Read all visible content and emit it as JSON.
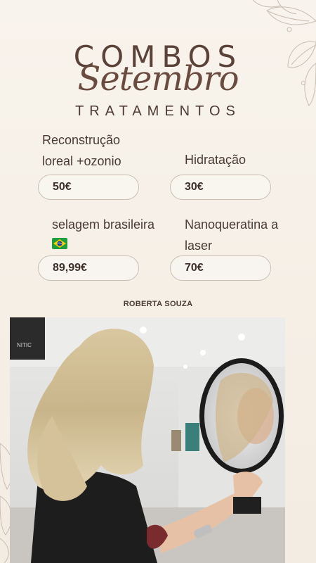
{
  "header": {
    "title": "COMBOS",
    "script": "Setembro",
    "subtitle": "TRATAMENTOS"
  },
  "items": [
    {
      "label_line1": "Reconstrução",
      "label_line2": "loreal +ozonio",
      "price": "50€"
    },
    {
      "label_line1": "Hidratação",
      "label_line2": "",
      "price": "30€"
    },
    {
      "label_line1": "selagem  brasileira",
      "label_line2": "",
      "price": "89,99€"
    },
    {
      "label_line1": "Nanoqueratina a",
      "label_line2": "laser",
      "price": "70€"
    }
  ],
  "flag_icon": "brazil-flag-icon",
  "author": "ROBERTA SOUZA",
  "photo": {
    "sign_text": "NITIC",
    "description_icon": "salon-photo"
  },
  "colors": {
    "background": "#f6f0e8",
    "text": "#4a3a32",
    "box_border": "#cbbfb4"
  }
}
